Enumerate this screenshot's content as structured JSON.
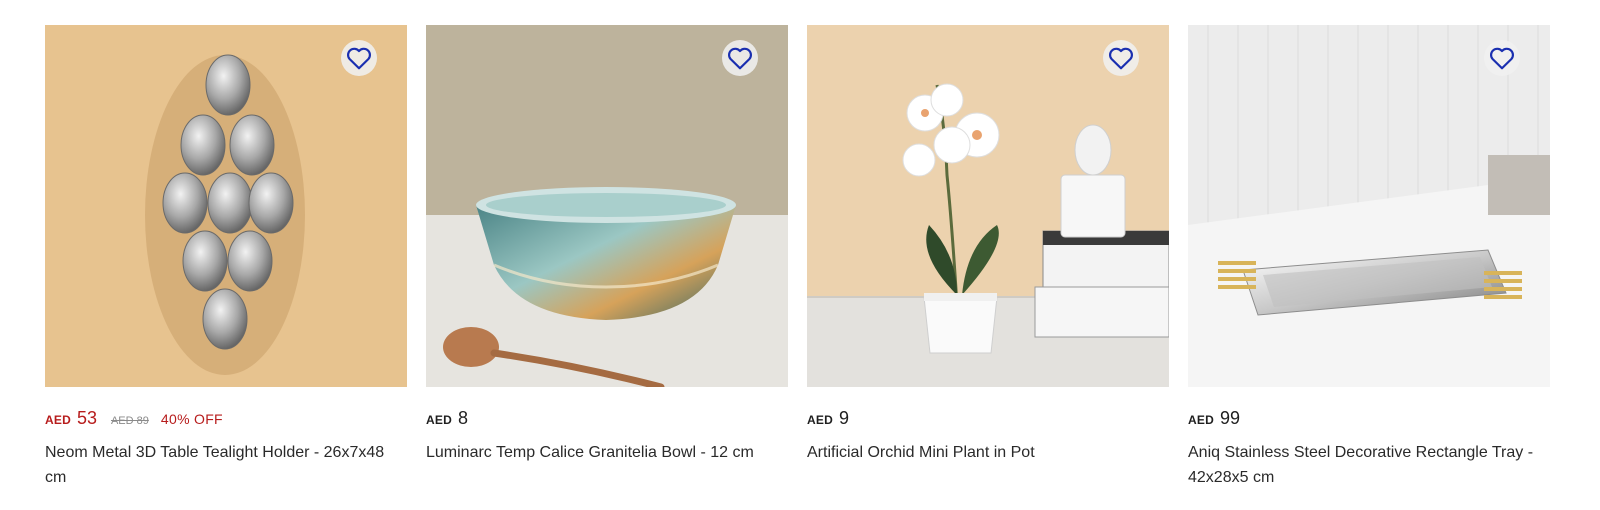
{
  "colors": {
    "sale": "#b71c1c",
    "heart": "#1a2fb0"
  },
  "products": [
    {
      "currency": "AED",
      "price": "53",
      "old_price": "AED 89",
      "discount": "40% OFF",
      "title": "Neom Metal 3D Table Tealight Holder - 26x7x48 cm",
      "icon": "heart-outline-icon"
    },
    {
      "currency": "AED",
      "price": "8",
      "title": "Luminarc Temp Calice Granitelia Bowl - 12 cm",
      "icon": "heart-outline-icon"
    },
    {
      "currency": "AED",
      "price": "9",
      "title": "Artificial Orchid Mini Plant in Pot",
      "icon": "heart-outline-icon"
    },
    {
      "currency": "AED",
      "price": "99",
      "title": "Aniq Stainless Steel Decorative Rectangle Tray - 42x28x5 cm",
      "icon": "heart-outline-icon"
    }
  ]
}
